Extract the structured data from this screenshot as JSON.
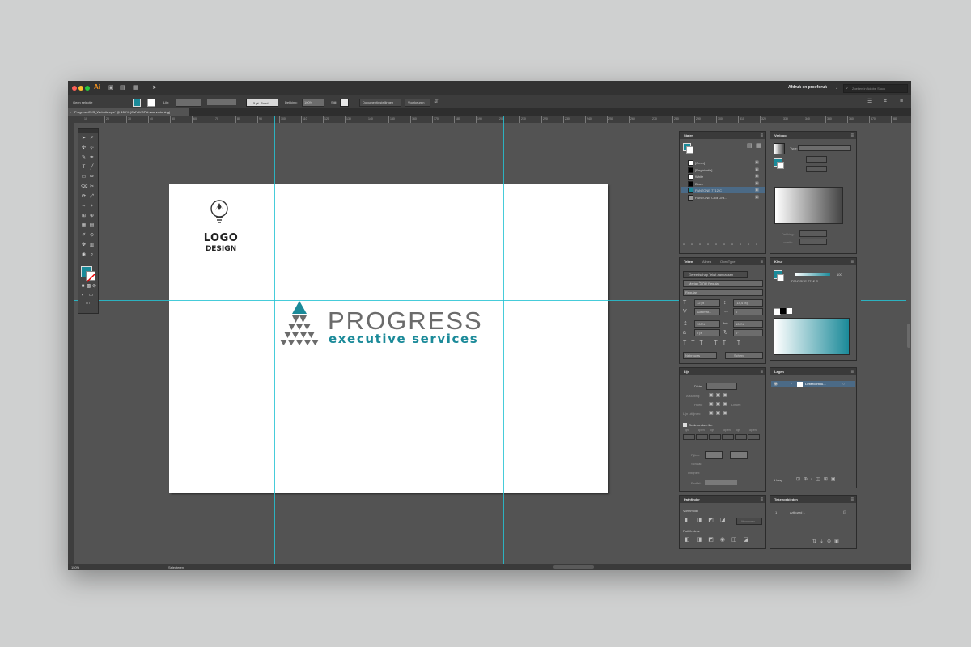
{
  "app": {
    "logo": "Ai",
    "workspace": "Afdruk en proefdruk",
    "search_placeholder": "Zoeken in Adobe Stock"
  },
  "control_bar": {
    "selection": "Geen selectie",
    "stroke_label": "Lijn:",
    "brush": "5 pt. Rond",
    "opacity_label": "Dekking:",
    "opacity_value": "100%",
    "style_label": "Stijl:",
    "doc_settings": "Documentinstellingen",
    "preferences": "Voorkeuren"
  },
  "document": {
    "tab_title": "Progress-EXS_Website.eps* @ 150% (CMYK/GPU-voorvertoning)"
  },
  "ruler_ticks": [
    "10",
    "20",
    "30",
    "40",
    "50",
    "60",
    "70",
    "80",
    "90",
    "100",
    "110",
    "120",
    "130",
    "140",
    "150",
    "160",
    "170",
    "180",
    "190",
    "200",
    "210",
    "220",
    "230",
    "240",
    "250",
    "260",
    "270",
    "280",
    "290",
    "300",
    "310",
    "320",
    "330",
    "340",
    "350",
    "360",
    "370",
    "380"
  ],
  "artwork": {
    "logo_line1": "LOGO",
    "logo_line2": "DESIGN",
    "brand_name": "PROGRESS",
    "brand_tagline": "executive services"
  },
  "colors": {
    "teal": "#1b8a99",
    "gray": "#6b6b6b"
  },
  "swatches_panel": {
    "title": "Stalen",
    "items": [
      "[Geen]",
      "[Registratie]",
      "White",
      "Black",
      "PANTONE 7712 C",
      "PANTONE Cool Gra..."
    ]
  },
  "gradient_panel": {
    "title": "Verloop",
    "type_label": "Type:",
    "opacity_label": "Dekking:",
    "location_label": "Locatie:"
  },
  "character_panel": {
    "tabs": [
      "Teken",
      "Alinea",
      "OpenType"
    ],
    "touch_type": "Gereedschap Tekst aanpassen",
    "font": "Meriad שׂראל Regular",
    "style": "Regular",
    "size": "12 pt",
    "leading": "(14,4 pt)",
    "kerning": "Automat...",
    "tracking": "0",
    "vscale": "100%",
    "hscale": "100%",
    "baseline": "0 pt",
    "rotation": "0°",
    "language": "Nebrouws",
    "antialias": "Scherp"
  },
  "color_panel": {
    "title": "Kleur",
    "value": "100",
    "name": "PANTONE 7712 C"
  },
  "stroke_panel": {
    "title": "Lijn",
    "weight_label": "Dikte:",
    "cap_label": "Afsluiting:",
    "corner_label": "Hoek:",
    "limit_label": "Limiet:",
    "align_label": "Lijn uitlijnen:",
    "dashed_label": "Onderbroken lijn",
    "dash_cols": [
      "lijn",
      "open",
      "lijn",
      "open",
      "lijn",
      "open"
    ],
    "arrow_label": "Pijlen:",
    "scale_label": "Schaal:",
    "align2_label": "Uitlijnen:",
    "profile_label": "Profiel:"
  },
  "layers_panel": {
    "title": "Lagen",
    "layer": "Lettercontou...",
    "count": "1 laag"
  },
  "pathfinder_panel": {
    "title": "Pathfinder",
    "shape_modes": "Vormmodi:",
    "pathfinders": "Pathfinders:",
    "expand": "Uitvouwen"
  },
  "artboards_panel": {
    "title": "Tekengebieden",
    "index": "1",
    "name": "Artboard 1"
  },
  "status_bar": {
    "zoom": "150%",
    "mode": "Selecteren"
  }
}
